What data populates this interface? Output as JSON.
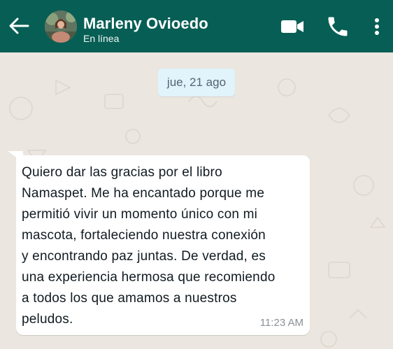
{
  "header": {
    "contact_name": "Marleny Ovioedo",
    "status": "En línea",
    "icons": [
      "back-arrow-icon",
      "video-call-icon",
      "phone-call-icon",
      "more-options-icon"
    ]
  },
  "chat": {
    "date_label": "jue, 21 ago",
    "messages": [
      {
        "lines": [
          "Quiero dar las gracias por el libro",
          "Namaspet. Me ha encantado porque me",
          "permitió vivir un momento único con mi",
          "mascota, fortaleciendo nuestra conexión",
          "y encontrando paz juntas. De verdad, es",
          "una experiencia hermosa que recomiendo",
          "a todos los que amamos a nuestros",
          "peludos."
        ],
        "time": "11:23 AM"
      }
    ]
  },
  "colors": {
    "header_bg": "#075e54",
    "chat_bg": "#ebe6df",
    "bubble_bg": "#ffffff",
    "date_pill_bg": "#e1f3fb"
  }
}
